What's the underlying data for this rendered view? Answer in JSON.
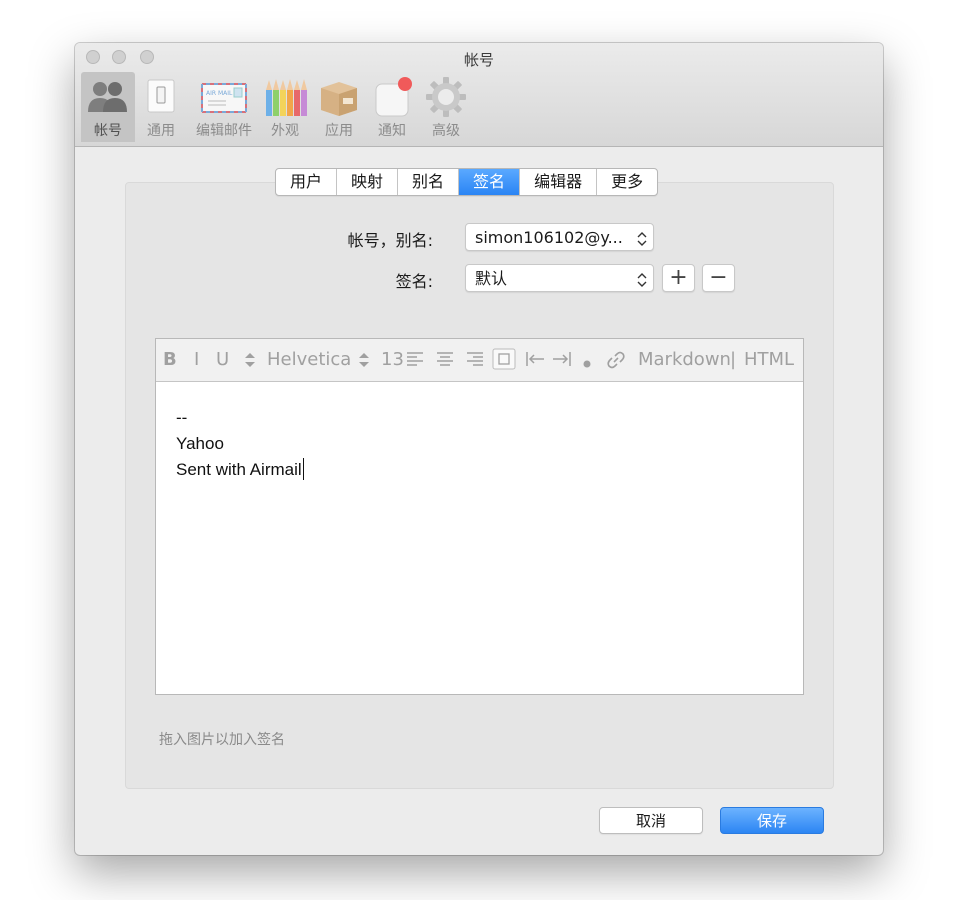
{
  "window": {
    "title": "帐号"
  },
  "toolbar": [
    {
      "label": "帐号",
      "icon": "accounts-icon",
      "active": true
    },
    {
      "label": "通用",
      "icon": "switch-icon"
    },
    {
      "label": "编辑邮件",
      "icon": "airmail-envelope-icon"
    },
    {
      "label": "外观",
      "icon": "color-pencils-icon"
    },
    {
      "label": "应用",
      "icon": "package-box-icon"
    },
    {
      "label": "通知",
      "icon": "notification-badge-icon"
    },
    {
      "label": "高级",
      "icon": "gear-icon"
    }
  ],
  "tabs": [
    {
      "label": "用户"
    },
    {
      "label": "映射"
    },
    {
      "label": "别名"
    },
    {
      "label": "签名",
      "selected": true
    },
    {
      "label": "编辑器"
    },
    {
      "label": "更多"
    }
  ],
  "form": {
    "account_label": "帐号，别名:",
    "account_value": "simon106102@y...",
    "signature_label": "签名:",
    "signature_value": "默认",
    "add_label": "+",
    "remove_label": "−"
  },
  "editor_toolbar": {
    "bold": "B",
    "italic": "I",
    "underline": "U",
    "font": "Helvetica",
    "size": "13",
    "markdown": "Markdown",
    "separator": "|",
    "html": "HTML"
  },
  "editor": {
    "lines": [
      "--",
      "Yahoo",
      "Sent with Airmail"
    ]
  },
  "hint": "拖入图片以加入签名",
  "buttons": {
    "cancel": "取消",
    "save": "保存"
  },
  "colors": {
    "accent": "#2a84f4",
    "notification_dot": "#f05a5a"
  }
}
